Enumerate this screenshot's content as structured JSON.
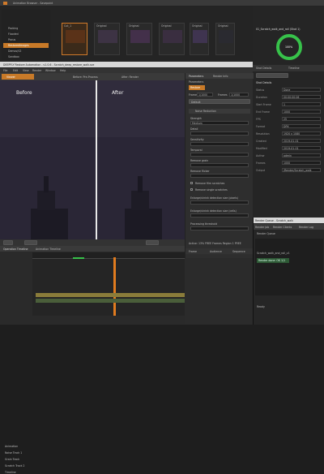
{
  "asset_browser": {
    "title": "Animation Browser - Savepoint",
    "folders": [
      "Packing",
      "Flooded",
      "Pocus",
      "RestoredImages",
      "Demos/V2",
      "Sandbox"
    ],
    "thumbs": [
      {
        "label": "Cut_1"
      },
      {
        "label": "Original"
      },
      {
        "label": "Original"
      },
      {
        "label": "Original"
      },
      {
        "label": "Original"
      },
      {
        "label": "Original"
      }
    ],
    "preview_title": "01_Scratch_walk_and_roll (Shot 1)",
    "progress_text": "100%",
    "info_lines": [
      "Compiling",
      "Playback",
      "Frames"
    ]
  },
  "main_window": {
    "title": "DEEPFLY Restore Automation - v1.0.6 - Scratch_deep_restore_walk.sce",
    "menu": [
      "File",
      "Edit",
      "View",
      "Render",
      "Window",
      "Help"
    ],
    "viewer_title": "Viewer",
    "viewer_tab_a": "Before: Pre-Process",
    "viewer_tab_b": "After: Render",
    "before_label": "Before",
    "after_label": "After"
  },
  "params": {
    "header": "Parameters",
    "tab2": "Render Info",
    "section_label": "Parameters",
    "preset_label": "Restore",
    "frame_label": "Frame",
    "frame_value": "1/1000",
    "frames_label": "Frames",
    "frames_value": "1/1000",
    "default_label": "Default",
    "section2": "Noise Reduction",
    "field_labels": [
      "Strength",
      "Detail",
      "Sensitivity",
      "Temporal",
      "Remove grain",
      "Remove flicker"
    ],
    "field_values": [
      "Medium",
      "",
      "",
      "",
      "",
      ""
    ],
    "check_labels": [
      "Remove film scratches",
      "Remove single scratches"
    ],
    "sub_labels": [
      "Enlarge/shrink detection size (pixels)",
      "Enlarge/shrink detection size (cells)",
      "Processing threshold"
    ],
    "bottom_label": "Active: 13%  FREE Frames  Region 1  FREE",
    "col_headers": [
      "Frame",
      "Audience",
      "Sequence"
    ],
    "status": "00:00:00:00"
  },
  "properties": {
    "title": "01_Scratch_walk_and_roll (Shot 1)",
    "tabs": [
      "Shot Details",
      "Timeline"
    ],
    "section": "Shot Details",
    "rows": [
      {
        "k": "Status",
        "v": "Done"
      },
      {
        "k": "Duration",
        "v": "00:00:00:06"
      },
      {
        "k": "Start Frame",
        "v": "1"
      },
      {
        "k": "End Frame",
        "v": "1000"
      },
      {
        "k": "FPS",
        "v": "25"
      },
      {
        "k": "Format",
        "v": "DPX"
      },
      {
        "k": "Resolution",
        "v": "1920 x 1080"
      },
      {
        "k": "Created",
        "v": "2019-01-01"
      },
      {
        "k": "Modified",
        "v": "2019-01-01"
      },
      {
        "k": "Author",
        "v": "admin"
      },
      {
        "k": "Frames",
        "v": "1000"
      },
      {
        "k": "Output",
        "v": "/Render/Scratch_walk"
      }
    ]
  },
  "render_panel": {
    "title": "Render Queue - Scratch_walk",
    "tabs": [
      "Render Job",
      "Render Clients",
      "Render Log"
    ],
    "subtitle": "Render Queue",
    "job": "Scratch_walk_and_roll_v1",
    "log": "Render done: OK  1/1",
    "status": "Ready"
  },
  "timeline": {
    "header": "Operation Timeline",
    "tab2": "Animation Timeline",
    "tracks": [
      "Animation",
      "Noise Track 1",
      "Grain Track",
      "Scratch Track 2",
      "Timeline"
    ],
    "current_frame": "0",
    "range": "1 - 1000"
  },
  "colors": {
    "accent": "#e07b1f",
    "progress": "#37c24a",
    "selected": "#c87a28"
  }
}
